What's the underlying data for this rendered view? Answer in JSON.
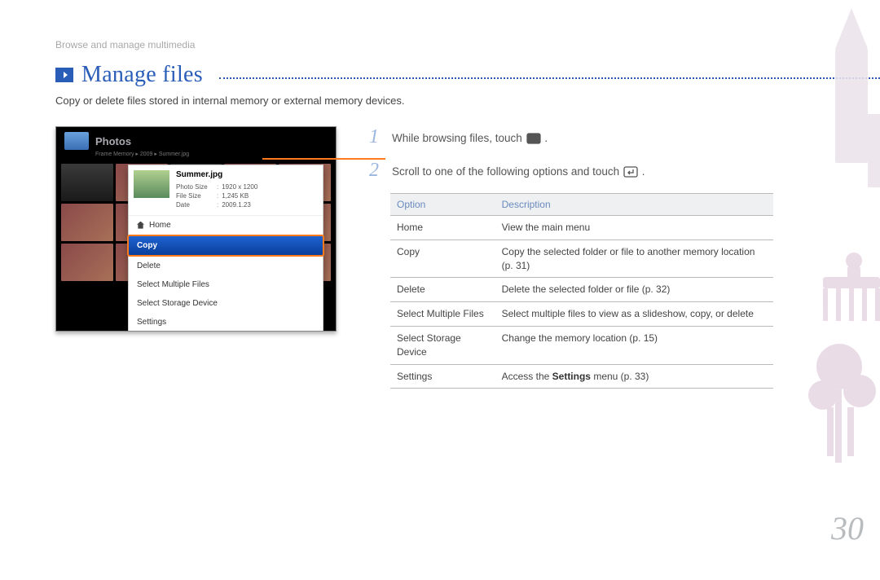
{
  "breadcrumb": "Browse and manage multimedia",
  "title": "Manage files",
  "subtitle": "Copy or delete files stored in internal memory or external memory devices.",
  "screenshot": {
    "header": "Photos",
    "sub": "Frame Memory ▸ 2009 ▸ Summer.jpg",
    "popup": {
      "filename": "Summer.jpg",
      "meta": [
        {
          "label": "Photo Size",
          "value": "1920 x 1200"
        },
        {
          "label": "File Size",
          "value": "1,245 KB"
        },
        {
          "label": "Date",
          "value": "2009.1.23"
        }
      ],
      "items": [
        {
          "label": "Home",
          "icon": true
        },
        {
          "label": "Copy",
          "highlight": true
        },
        {
          "label": "Delete"
        },
        {
          "label": "Select Multiple Files"
        },
        {
          "label": "Select Storage Device"
        },
        {
          "label": "Settings"
        }
      ]
    }
  },
  "steps": [
    {
      "num": "1",
      "text_before": "While browsing files, touch ",
      "icon": "menu",
      "text_after": "."
    },
    {
      "num": "2",
      "text_before": "Scroll to one of the following options and touch ",
      "icon": "enter",
      "text_after": "."
    }
  ],
  "table": {
    "headers": [
      "Option",
      "Description"
    ],
    "rows": [
      {
        "option": "Home",
        "desc": "View the main menu"
      },
      {
        "option": "Copy",
        "desc": "Copy the selected folder or file to another memory location (p. 31)"
      },
      {
        "option": "Delete",
        "desc": "Delete the selected folder or file (p. 32)"
      },
      {
        "option": "Select Multiple Files",
        "desc": "Select multiple files to view as a slideshow, copy, or delete"
      },
      {
        "option": "Select Storage Device",
        "desc": "Change the memory location (p. 15)"
      },
      {
        "option": "Settings",
        "desc_html": "Access the <b>Settings</b> menu (p. 33)"
      }
    ]
  },
  "page_number": "30"
}
